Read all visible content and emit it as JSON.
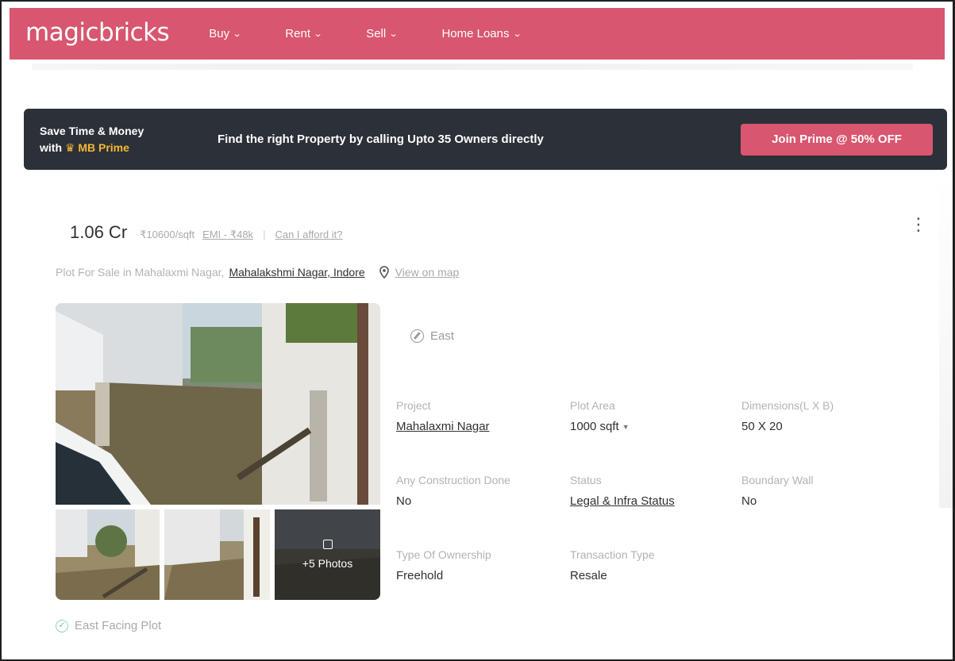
{
  "header": {
    "logo": "magicbricks",
    "nav": [
      {
        "label": "Buy"
      },
      {
        "label": "Rent"
      },
      {
        "label": "Sell"
      },
      {
        "label": "Home Loans"
      }
    ],
    "brand_color": "#d8566f"
  },
  "prime_banner": {
    "line1": "Save Time & Money",
    "line2_prefix": "with",
    "line2_brand": "MB Prime",
    "message": "Find the right Property by calling Upto 35 Owners directly",
    "button_label": "Join Prime @ 50% OFF",
    "background": "#2c3038",
    "accent": "#f6b733"
  },
  "listing": {
    "price": "1.06 Cr",
    "rate": "₹10600/sqft",
    "emi": "EMI - ₹48k",
    "separator": "|",
    "afford_link": "Can I afford it?",
    "title": "Plot For Sale in Mahalaxmi Nagar,",
    "locality": "Mahalakshmi Nagar, Indore",
    "view_map": "View on map",
    "more_photos": "+5 Photos",
    "facing": "East",
    "details": [
      {
        "label": "Project",
        "value": "Mahalaxmi Nagar",
        "link": true
      },
      {
        "label": "Plot Area",
        "value": "1000 sqft",
        "dropdown": true
      },
      {
        "label": "Dimensions(L X B)",
        "value": "50 X 20"
      },
      {
        "label": "Any Construction Done",
        "value": "No"
      },
      {
        "label": "Status",
        "value": "Legal & Infra Status",
        "link": true
      },
      {
        "label": "Boundary Wall",
        "value": "No"
      },
      {
        "label": "Type Of Ownership",
        "value": "Freehold"
      },
      {
        "label": "Transaction Type",
        "value": "Resale"
      }
    ],
    "highlight": "East Facing Plot"
  }
}
